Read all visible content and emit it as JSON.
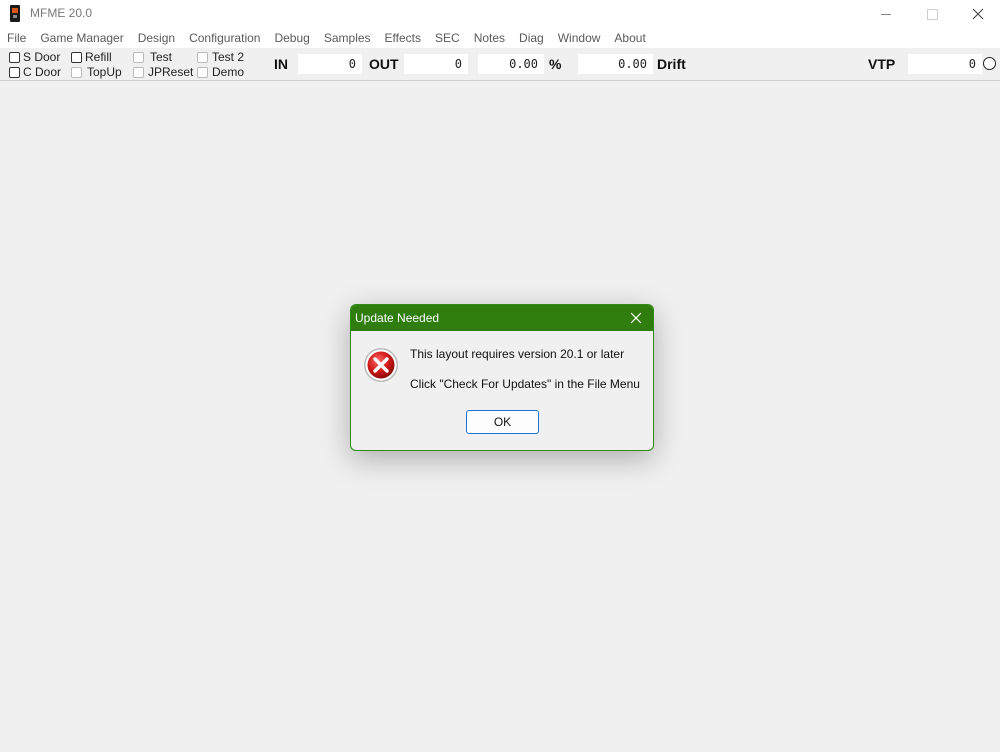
{
  "window": {
    "title": "MFME 20.0",
    "minimize_icon": "minimize-icon",
    "maximize_icon": "maximize-icon",
    "close_icon": "close-icon"
  },
  "menu": {
    "items": [
      "File",
      "Game Manager",
      "Design",
      "Configuration",
      "Debug",
      "Samples",
      "Effects",
      "SEC",
      "Notes",
      "Diag",
      "Window",
      "About"
    ]
  },
  "toolbar": {
    "checkboxes": [
      {
        "label": "S Door",
        "checked": false
      },
      {
        "label": "C Door",
        "checked": false
      },
      {
        "label": "Refill",
        "checked": false
      },
      {
        "label": "TopUp",
        "checked": false
      },
      {
        "label": "Test",
        "checked": false
      },
      {
        "label": "JPReset",
        "checked": false
      },
      {
        "label": "Test 2",
        "checked": false
      },
      {
        "label": "Demo",
        "checked": false
      }
    ],
    "in_label": "IN",
    "in_value": "0",
    "out_label": "OUT",
    "out_value": "0",
    "percent_value": "0.00",
    "percent_label": "%",
    "drift_value": "0.00",
    "drift_label": "Drift",
    "vtp_label": "VTP",
    "vtp_value": "0"
  },
  "dialog": {
    "title": "Update Needed",
    "message_line1": "This layout requires version 20.1 or later",
    "message_line2": "Click \"Check For Updates\" in the File Menu",
    "ok_label": "OK",
    "icon": "error-icon",
    "title_color": "#2e7d0e"
  }
}
